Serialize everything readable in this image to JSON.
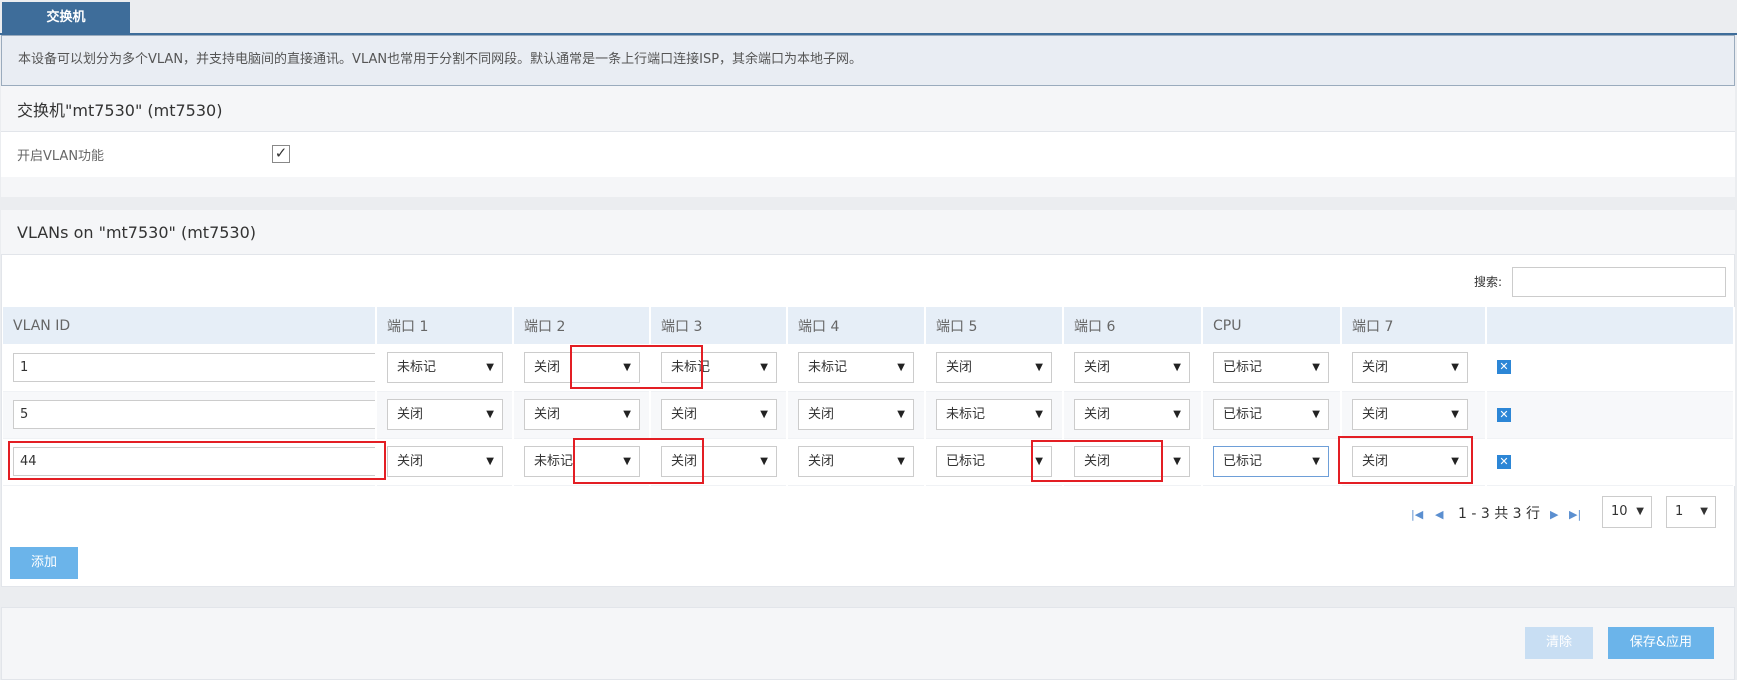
{
  "tab": {
    "label": "交换机"
  },
  "banner": {
    "text": "本设备可以划分为多个VLAN，并支持电脑间的直接通讯。VLAN也常用于分割不同网段。默认通常是一条上行端口连接ISP，其余端口为本地子网。"
  },
  "switch_section": {
    "title": "交换机\"mt7530\" (mt7530)",
    "enable_vlan_label": "开启VLAN功能",
    "enable_vlan_checked": true
  },
  "vlans_section": {
    "title": "VLANs on \"mt7530\" (mt7530)",
    "search_label": "搜索:",
    "search_value": "",
    "columns": [
      "VLAN ID",
      "端口 1",
      "端口 2",
      "端口 3",
      "端口 4",
      "端口 5",
      "端口 6",
      "CPU",
      "端口 7"
    ],
    "rows": [
      {
        "id": "1",
        "cells": [
          "未标记",
          "关闭",
          "未标记",
          "未标记",
          "关闭",
          "关闭",
          "已标记",
          "关闭"
        ]
      },
      {
        "id": "5",
        "cells": [
          "关闭",
          "关闭",
          "关闭",
          "关闭",
          "未标记",
          "关闭",
          "已标记",
          "关闭"
        ]
      },
      {
        "id": "44",
        "cells": [
          "关闭",
          "未标记",
          "关闭",
          "关闭",
          "已标记",
          "关闭",
          "已标记",
          "关闭"
        ]
      }
    ],
    "delete_icon": "close-icon"
  },
  "pagination": {
    "summary": "1 - 3 共 3 行",
    "page_size": "10",
    "page": "1"
  },
  "buttons": {
    "add": "添加",
    "clear": "清除",
    "save_apply": "保存&应用"
  },
  "colors": {
    "accent": "#3e6d9a",
    "button": "#6bb4ea",
    "highlight": "#e31e24"
  }
}
